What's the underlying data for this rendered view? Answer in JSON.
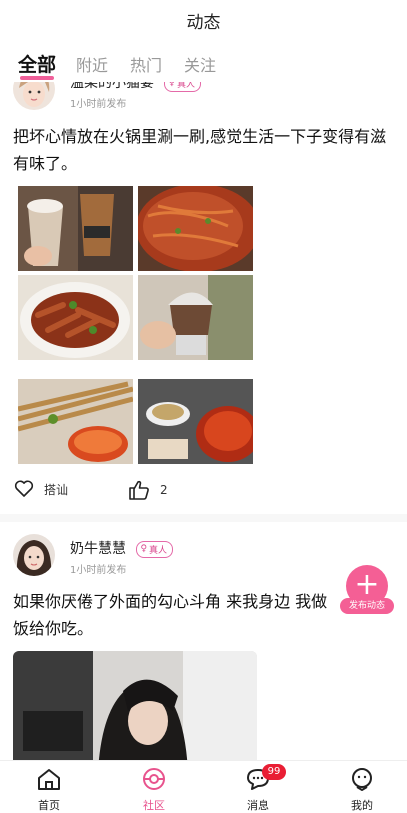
{
  "header": {
    "title": "动态"
  },
  "tabs": [
    {
      "label": "全部",
      "active": true
    },
    {
      "label": "附近",
      "active": false
    },
    {
      "label": "热门",
      "active": false
    },
    {
      "label": "关注",
      "active": false
    }
  ],
  "posts": [
    {
      "username": "温柔的小猫宴",
      "badge": "真人",
      "time": "1小时前发布",
      "text": "把坏心情放在火锅里涮一刷,感觉生活一下子变得有滋有味了。",
      "images": [
        "bubble-tea-photo",
        "spicy-noodles-photo",
        "chicken-feet-photo",
        "ice-cream-photo",
        "skewers-photo",
        "hotpot-photo"
      ],
      "actions": {
        "chat_label": "搭讪",
        "like_count": "2"
      }
    },
    {
      "username": "奶牛慧慧",
      "badge": "真人",
      "time": "1小时前发布",
      "text": "如果你厌倦了外面的勾心斗角 来我身边 我做饭给你吃。",
      "images": [
        "girl-portrait-photo"
      ]
    }
  ],
  "fab": {
    "label": "发布动态",
    "icon": "plus-icon"
  },
  "nav": [
    {
      "label": "首页",
      "icon": "home-icon",
      "active": false
    },
    {
      "label": "社区",
      "icon": "community-icon",
      "active": true
    },
    {
      "label": "消息",
      "icon": "message-icon",
      "active": false,
      "badge": "99"
    },
    {
      "label": "我的",
      "icon": "profile-icon",
      "active": false
    }
  ],
  "colors": {
    "accent": "#f0609a",
    "badge_red": "#e91e34"
  }
}
